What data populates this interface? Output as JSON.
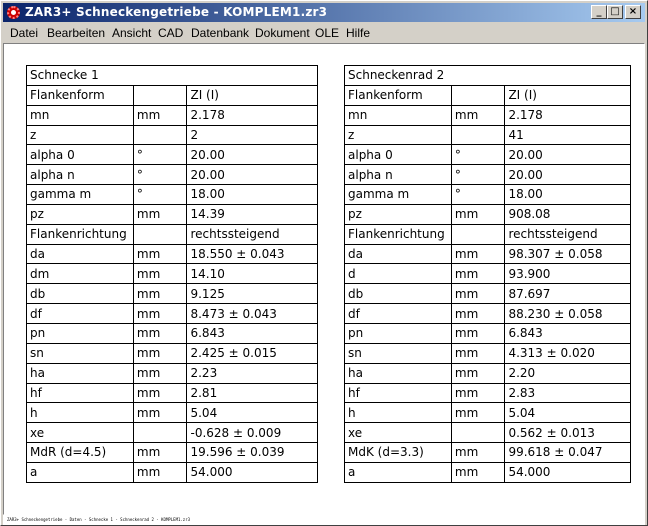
{
  "window": {
    "title": "ZAR3+ Schneckengetriebe - KOMPLEM1.zr3",
    "minimize": "_",
    "maximize": "□",
    "close": "×"
  },
  "menu": [
    {
      "label": "Datei"
    },
    {
      "label": "Bearbeiten"
    },
    {
      "label": "Ansicht"
    },
    {
      "label": "CAD"
    },
    {
      "label": "Datenbank"
    },
    {
      "label": "Dokument"
    },
    {
      "label": "OLE"
    },
    {
      "label": "Hilfe"
    }
  ],
  "schnecke": {
    "title": "Schnecke 1",
    "rows": [
      {
        "name": "Flankenform",
        "unit": "",
        "value": "ZI (I)"
      },
      {
        "name": "mn",
        "unit": "mm",
        "value": "2.178"
      },
      {
        "name": "z",
        "unit": "",
        "value": "2"
      },
      {
        "name": "alpha 0",
        "unit": "°",
        "value": "20.00"
      },
      {
        "name": "alpha n",
        "unit": "°",
        "value": "20.00"
      },
      {
        "name": "gamma m",
        "unit": "°",
        "value": "18.00"
      },
      {
        "name": "pz",
        "unit": "mm",
        "value": "14.39"
      },
      {
        "name": "Flankenrichtung",
        "unit": "",
        "value": "rechtssteigend"
      },
      {
        "name": "da",
        "unit": "mm",
        "value": "18.550 ± 0.043"
      },
      {
        "name": "dm",
        "unit": "mm",
        "value": "14.10"
      },
      {
        "name": "db",
        "unit": "mm",
        "value": "9.125"
      },
      {
        "name": "df",
        "unit": "mm",
        "value": "8.473 ± 0.043"
      },
      {
        "name": "pn",
        "unit": "mm",
        "value": "6.843"
      },
      {
        "name": "sn",
        "unit": "mm",
        "value": "2.425 ± 0.015"
      },
      {
        "name": "ha",
        "unit": "mm",
        "value": "2.23"
      },
      {
        "name": "hf",
        "unit": "mm",
        "value": "2.81"
      },
      {
        "name": "h",
        "unit": "mm",
        "value": "5.04"
      },
      {
        "name": "xe",
        "unit": "",
        "value": "-0.628 ± 0.009"
      },
      {
        "name": "MdR (d=4.5)",
        "unit": "mm",
        "value": "19.596 ± 0.039"
      },
      {
        "name": "a",
        "unit": "mm",
        "value": "54.000"
      }
    ]
  },
  "schneckenrad": {
    "title": "Schneckenrad 2",
    "rows": [
      {
        "name": "Flankenform",
        "unit": "",
        "value": "ZI (I)"
      },
      {
        "name": "mn",
        "unit": "mm",
        "value": "2.178"
      },
      {
        "name": "z",
        "unit": "",
        "value": "41"
      },
      {
        "name": "alpha 0",
        "unit": "°",
        "value": "20.00"
      },
      {
        "name": "alpha n",
        "unit": "°",
        "value": "20.00"
      },
      {
        "name": "gamma m",
        "unit": "°",
        "value": "18.00"
      },
      {
        "name": "pz",
        "unit": "mm",
        "value": "908.08"
      },
      {
        "name": "Flankenrichtung",
        "unit": "",
        "value": "rechtssteigend"
      },
      {
        "name": "da",
        "unit": "mm",
        "value": "98.307 ± 0.058"
      },
      {
        "name": "d",
        "unit": "mm",
        "value": "93.900"
      },
      {
        "name": "db",
        "unit": "mm",
        "value": "87.697"
      },
      {
        "name": "df",
        "unit": "mm",
        "value": "88.230 ± 0.058"
      },
      {
        "name": "pn",
        "unit": "mm",
        "value": "6.843"
      },
      {
        "name": "sn",
        "unit": "mm",
        "value": "4.313 ± 0.020"
      },
      {
        "name": "ha",
        "unit": "mm",
        "value": "2.20"
      },
      {
        "name": "hf",
        "unit": "mm",
        "value": "2.83"
      },
      {
        "name": "h",
        "unit": "mm",
        "value": "5.04"
      },
      {
        "name": "xe",
        "unit": "",
        "value": "0.562 ± 0.013"
      },
      {
        "name": "MdK (d=3.3)",
        "unit": "mm",
        "value": "99.618 ± 0.047"
      },
      {
        "name": "a",
        "unit": "mm",
        "value": "54.000"
      }
    ]
  },
  "status": {
    "text": "ZAR3+ Schneckengetriebe - Daten - Schnecke 1 - Schneckenrad 2 - KOMPLEM1.zr3"
  },
  "icons": {
    "app": "gear-icon",
    "minimize": "minimize-icon",
    "maximize": "maximize-icon",
    "close": "close-icon"
  }
}
